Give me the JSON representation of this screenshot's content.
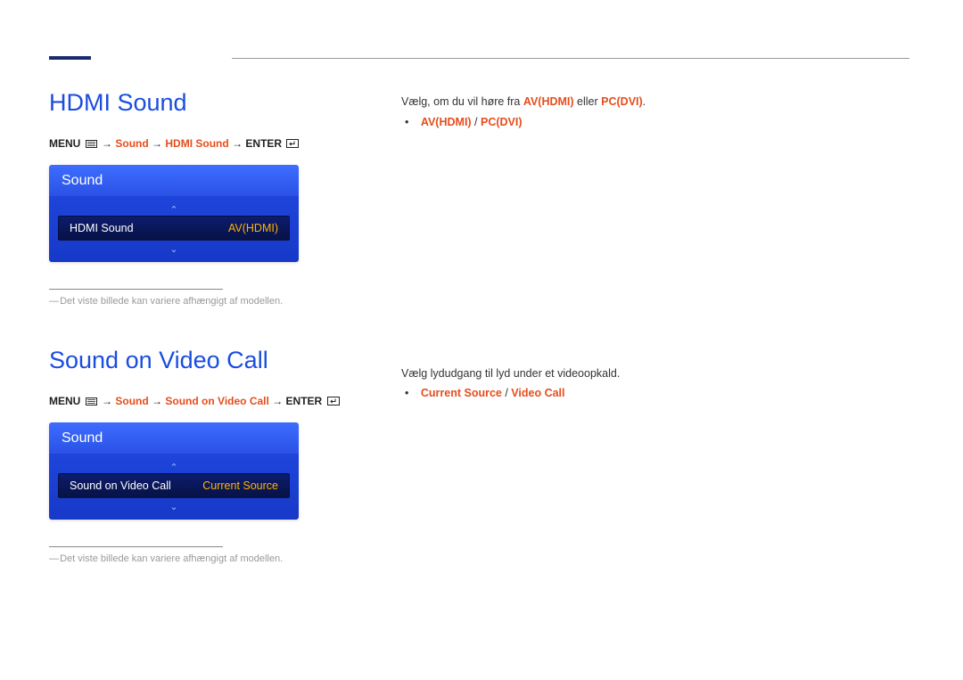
{
  "sec1": {
    "title": "HDMI Sound",
    "bc_menu": "MENU",
    "bc_l1": "Sound",
    "bc_l2": "HDMI Sound",
    "bc_enter": "ENTER",
    "osd_header": "Sound",
    "osd_item_label": "HDMI Sound",
    "osd_item_value": "AV(HDMI)",
    "note": "Det viste billede kan variere afhængigt af modellen.",
    "desc_prefix": "Vælg, om du vil høre fra ",
    "desc_b1": "AV(HDMI)",
    "desc_mid": " eller ",
    "desc_b2": "PC(DVI)",
    "desc_suffix": ".",
    "opt1": "AV(HDMI)",
    "opt_sep": " / ",
    "opt2": "PC(DVI)"
  },
  "sec2": {
    "title": "Sound on Video Call",
    "bc_menu": "MENU",
    "bc_l1": "Sound",
    "bc_l2": "Sound on Video Call",
    "bc_enter": "ENTER",
    "osd_header": "Sound",
    "osd_item_label": "Sound on Video Call",
    "osd_item_value": "Current Source",
    "note": "Det viste billede kan variere afhængigt af modellen.",
    "desc": "Vælg lydudgang til lyd under et videoopkald.",
    "opt1": "Current Source",
    "opt_sep": " / ",
    "opt2": "Video Call"
  },
  "arrow_sep": " → "
}
